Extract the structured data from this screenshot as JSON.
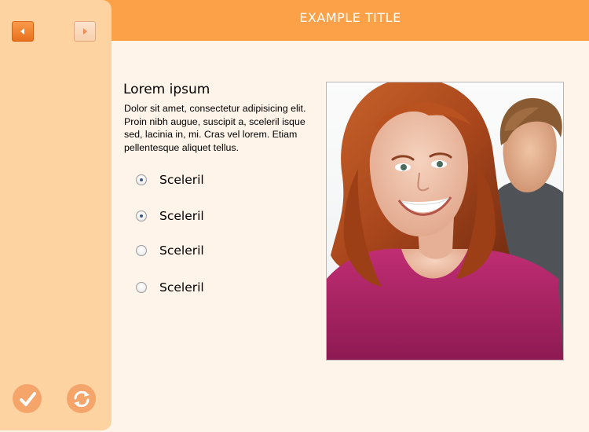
{
  "header": {
    "title": "EXAMPLE TITLE"
  },
  "colors": {
    "header_bg": "#fca147",
    "sidebar_bg": "#fdd3a2",
    "page_bg": "#fef4e9",
    "accent": "#f5a46a"
  },
  "sidebar": {
    "back_icon": "triangle-left-icon",
    "forward_icon": "triangle-right-icon",
    "submit_icon": "checkmark-icon",
    "reset_icon": "refresh-icon"
  },
  "content": {
    "title": "Lorem ipsum",
    "body": "Dolor sit amet, consectetur adipisicing elit. Proin nibh augue, suscipit a, sceleril isque sed, lacinia in, mi. Cras vel lorem. Etiam pellentesque aliquet tellus."
  },
  "options": [
    {
      "label": "Sceleril",
      "selected": true
    },
    {
      "label": "Sceleril",
      "selected": true
    },
    {
      "label": "Sceleril",
      "selected": false
    },
    {
      "label": "Sceleril",
      "selected": false
    }
  ]
}
